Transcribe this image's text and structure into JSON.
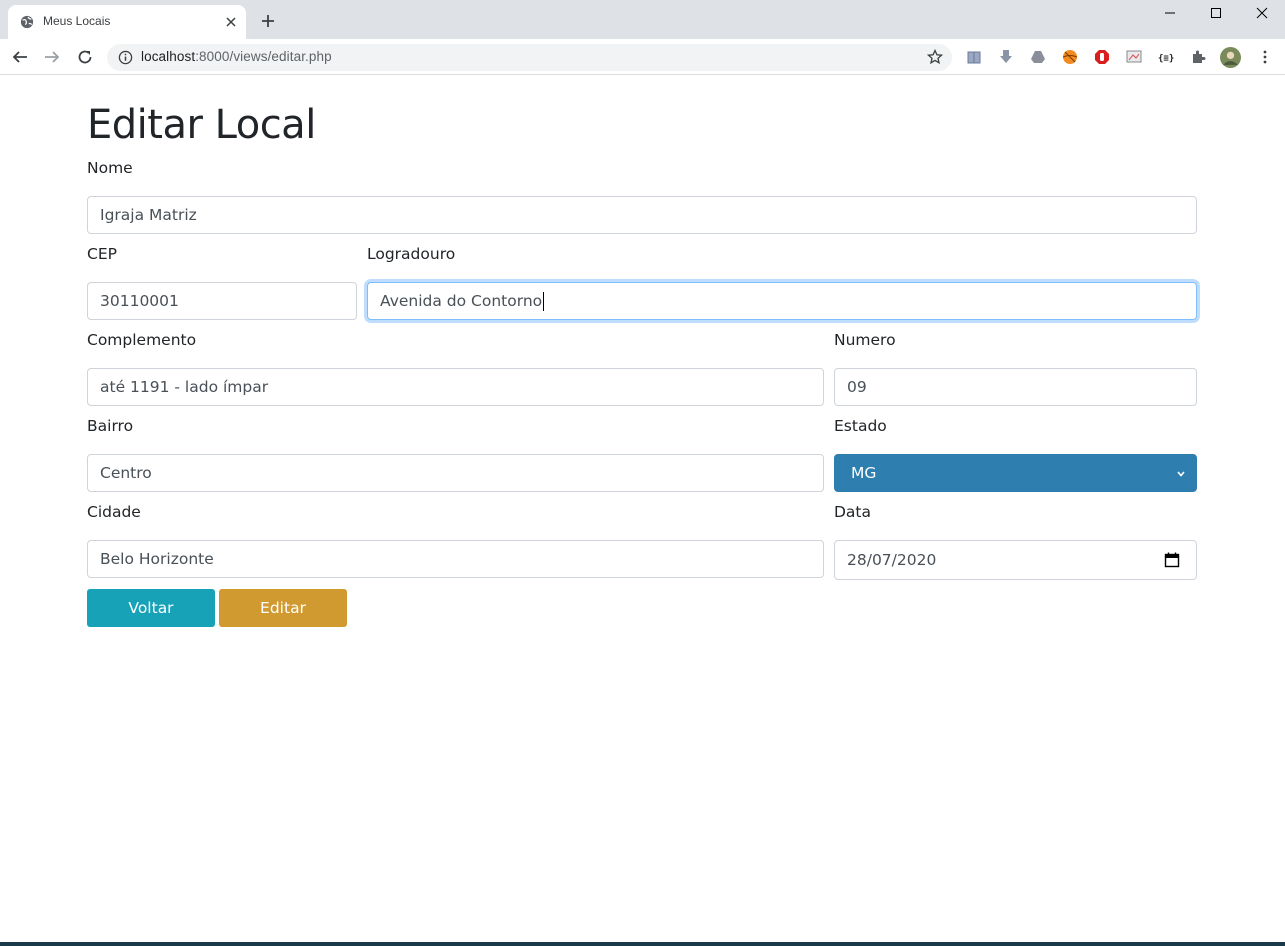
{
  "browser": {
    "tab_title": "Meus Locais",
    "url_host": "localhost",
    "url_path": ":8000/views/editar.php"
  },
  "page": {
    "title": "Editar Local"
  },
  "form": {
    "nome": {
      "label": "Nome",
      "value": "Igraja Matriz"
    },
    "cep": {
      "label": "CEP",
      "value": "30110001"
    },
    "logradouro": {
      "label": "Logradouro",
      "value": "Avenida do Contorno"
    },
    "complemento": {
      "label": "Complemento",
      "value": "até 1191 - lado ímpar"
    },
    "numero": {
      "label": "Numero",
      "value": "09"
    },
    "bairro": {
      "label": "Bairro",
      "value": "Centro"
    },
    "estado": {
      "label": "Estado",
      "value": "MG"
    },
    "cidade": {
      "label": "Cidade",
      "value": "Belo Horizonte"
    },
    "data": {
      "label": "Data",
      "value": "28/07/2020"
    }
  },
  "buttons": {
    "voltar": "Voltar",
    "editar": "Editar"
  },
  "colors": {
    "voltar_bg": "#17a2b8",
    "editar_bg": "#d09a31",
    "select_bg": "#2e7eaf"
  }
}
